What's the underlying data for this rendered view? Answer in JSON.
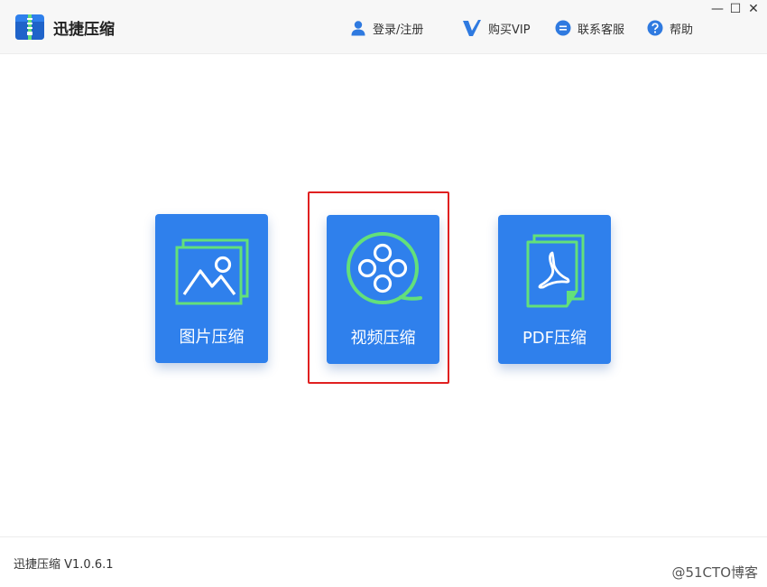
{
  "app": {
    "title": "迅捷压缩"
  },
  "nav": {
    "login": "登录/注册",
    "vip": "购买VIP",
    "support": "联系客服",
    "help": "帮助"
  },
  "window_controls": {
    "minimize": "—",
    "maximize": "☐",
    "close": "✕"
  },
  "cards": [
    {
      "label": "图片压缩",
      "icon": "image-icon"
    },
    {
      "label": "视频压缩",
      "icon": "film-reel-icon"
    },
    {
      "label": "PDF压缩",
      "icon": "pdf-icon"
    }
  ],
  "footer": {
    "version": "迅捷压缩 V1.0.6.1"
  },
  "watermark": "@51CTO博客",
  "colors": {
    "card_bg": "#2f80ec",
    "icon_accent": "#63e07a",
    "highlight_border": "#e02020",
    "nav_icon": "#2f7ae0"
  }
}
